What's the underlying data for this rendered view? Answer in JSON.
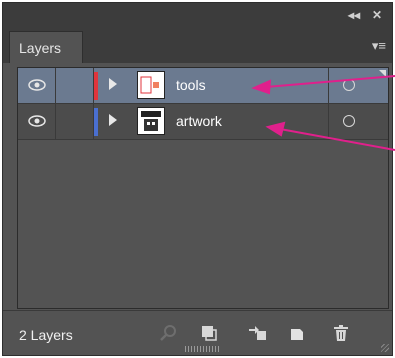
{
  "panel": {
    "title": "Layers",
    "controls": {
      "collapse": "◂◂",
      "close": "✕",
      "menu": "▾≡"
    }
  },
  "layers": [
    {
      "name": "tools",
      "color": "#e0343c",
      "selected": true,
      "visible": true
    },
    {
      "name": "artwork",
      "color": "#4a6fd0",
      "selected": false,
      "visible": true
    }
  ],
  "footer": {
    "count_label": "2 Layers",
    "buttons": [
      "locate-object",
      "make-clipping-mask",
      "create-sublayer",
      "create-layer",
      "delete-layer"
    ]
  },
  "annotation": {
    "arrow_color": "#e0208c"
  }
}
